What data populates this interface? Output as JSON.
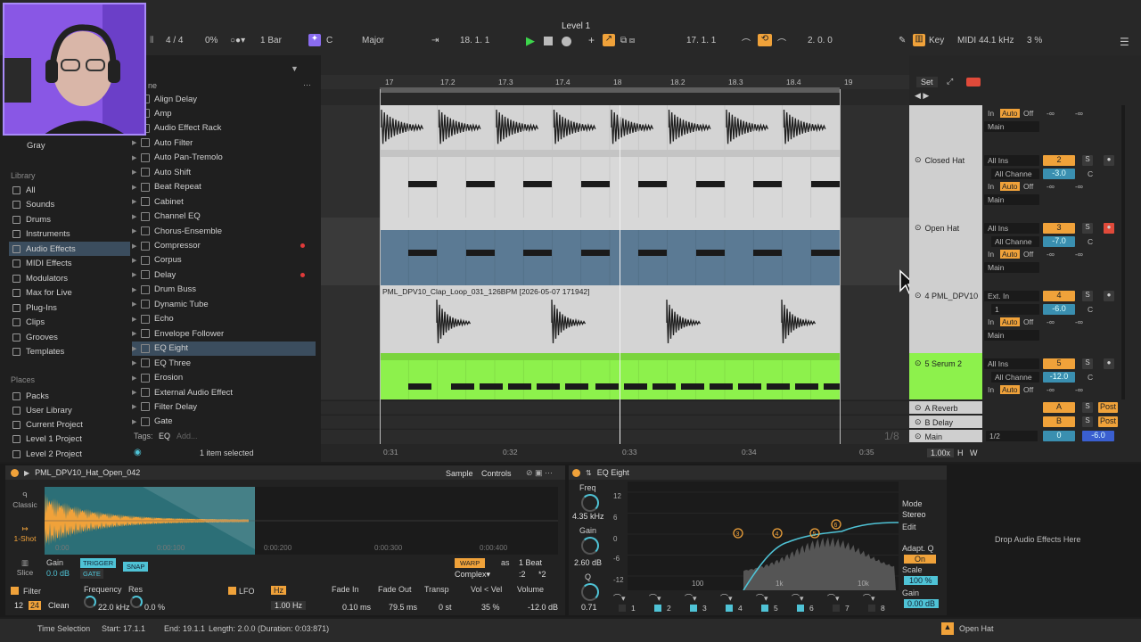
{
  "window": {
    "title": "Level 1"
  },
  "transport": {
    "signature": "4 / 4",
    "swing": "0%",
    "quantize": "1 Bar",
    "key": "C",
    "scale": "Major",
    "position": "18.  1.  1",
    "loop_start": "17.  1.  1",
    "loop_length": "2.  0.  0",
    "key_label": "Key",
    "midi_label": "MIDI",
    "sample_rate": "44.1 kHz",
    "cpu": "3 %"
  },
  "browser": {
    "collection": "Gray",
    "library_heading": "Library",
    "library": [
      "All",
      "Sounds",
      "Drums",
      "Instruments",
      "Audio Effects",
      "MIDI Effects",
      "Modulators",
      "Max for Live",
      "Plug-Ins",
      "Clips",
      "Grooves",
      "Templates"
    ],
    "places_heading": "Places",
    "places": [
      "Packs",
      "User Library",
      "Current Project",
      "Level 1 Project",
      "Level 2 Project"
    ],
    "column_header": "ne",
    "effects": [
      "Align Delay",
      "Amp",
      "Audio Effect Rack",
      "Auto Filter",
      "Auto Pan-Tremolo",
      "Auto Shift",
      "Beat Repeat",
      "Cabinet",
      "Channel EQ",
      "Chorus-Ensemble",
      "Compressor",
      "Corpus",
      "Delay",
      "Drum Buss",
      "Dynamic Tube",
      "Echo",
      "Envelope Follower",
      "EQ Eight",
      "EQ Three",
      "Erosion",
      "External Audio Effect",
      "Filter Delay",
      "Gate"
    ],
    "tags_label": "Tags:",
    "tag": "EQ",
    "tag_add": "Add...",
    "selection": "1 item selected"
  },
  "arrangement": {
    "ruler": [
      "17",
      "17.2",
      "17.3",
      "17.4",
      "18",
      "18.2",
      "18.3",
      "18.4",
      "19"
    ],
    "time_ruler": [
      "0:31",
      "0:32",
      "0:33",
      "0:34",
      "0:35"
    ],
    "clip_title": "PML_DPV10_Clap_Loop_031_126BPM [2026-05-07 171942]",
    "page": "1/8"
  },
  "mixer": {
    "set_label": "Set",
    "tracks": [
      {
        "name": "",
        "num": "",
        "in": "",
        "ch": "",
        "vol": "-∞",
        "vol2": "-∞",
        "out": "Main"
      },
      {
        "name": "Closed Hat",
        "num": "2",
        "in": "All Ins",
        "ch": "All Channe",
        "gain": "-3.0",
        "pan": "C",
        "out": "Main"
      },
      {
        "name": "Open Hat",
        "num": "3",
        "in": "All Ins",
        "ch": "All Channe",
        "gain": "-7.0",
        "pan": "C",
        "out": "Main"
      },
      {
        "name": "4 PML_DPV10",
        "num": "4",
        "in": "Ext. In",
        "ch": "1",
        "gain": "-6.0",
        "pan": "C",
        "out": "Main"
      },
      {
        "name": "5 Serum 2",
        "num": "5",
        "in": "All Ins",
        "ch": "All Channe",
        "gain": "-12.0",
        "pan": "C",
        "out": ""
      }
    ],
    "monitor": {
      "in": "In",
      "auto": "Auto",
      "off": "Off",
      "inf": "-∞"
    },
    "returns": [
      {
        "name": "A Reverb",
        "letter": "A",
        "post": "Post"
      },
      {
        "name": "B Delay",
        "letter": "B",
        "post": "Post"
      }
    ],
    "main": {
      "name": "Main",
      "cue": "1/2",
      "vol": "0",
      "gain": "-6.0"
    },
    "zoom": "1.00x",
    "h": "H",
    "w": "W"
  },
  "simpler": {
    "title": "PML_DPV10_Hat_Open_042",
    "tabs": [
      "Sample",
      "Controls"
    ],
    "modes": [
      "Classic",
      "1-Shot",
      "Slice"
    ],
    "times": [
      "0:00",
      "0:00:100",
      "0:00:200",
      "0:00:300",
      "0:00:400"
    ],
    "gain_label": "Gain",
    "gain": "0.0 dB",
    "trigger": "TRIGGER",
    "gate": "GATE",
    "snap": "SNAP",
    "warp": "WARP",
    "as": "as",
    "beat": "1 Beat",
    "complex": "Complex▾",
    "x2a": ":2",
    "x2b": "*2",
    "filter": "Filter",
    "f12": "12",
    "f24": "24",
    "clean": "Clean",
    "freq_label": "Frequency",
    "freq": "22.0 kHz",
    "res_label": "Res",
    "res": "0.0 %",
    "lfo": "LFO",
    "hz": "Hz",
    "lfo_rate": "1.00 Hz",
    "fadein_label": "Fade In",
    "fadein": "0.10 ms",
    "fadeout_label": "Fade Out",
    "fadeout": "79.5 ms",
    "transp_label": "Transp",
    "transp": "0 st",
    "vel_label": "Vol < Vel",
    "vel": "35 %",
    "volume_label": "Volume",
    "volume": "-12.0 dB"
  },
  "eq": {
    "title": "EQ Eight",
    "freq_label": "Freq",
    "freq": "4.35 kHz",
    "gain_label": "Gain",
    "gain": "2.60 dB",
    "q_label": "Q",
    "q": "0.71",
    "ylabels": [
      "12",
      "6",
      "0",
      "-6",
      "-12"
    ],
    "xlabels": [
      "100",
      "1k",
      "10k"
    ],
    "mode_label": "Mode",
    "mode": "Stereo",
    "edit_label": "Edit",
    "adapt_label": "Adapt. Q",
    "adapt": "On",
    "scale_label": "Scale",
    "scale": "100 %",
    "out_gain_label": "Gain",
    "out_gain": "0.00 dB",
    "bands": [
      "1",
      "2",
      "3",
      "4",
      "5",
      "6",
      "7",
      "8"
    ],
    "points": [
      "3",
      "4",
      "5",
      "6"
    ]
  },
  "drop_hint": "Drop Audio Effects Here",
  "status": {
    "mode": "Time Selection",
    "start": "Start: 17.1.1",
    "end": "End: 19.1.1",
    "length": "Length: 2.0.0 (Duration: 0:03:871)",
    "track": "Open Hat"
  },
  "colors": {
    "accent": "#f0a23a",
    "green": "#8df14c",
    "blue": "#5b7a94",
    "cyan": "#4fc3d6"
  }
}
